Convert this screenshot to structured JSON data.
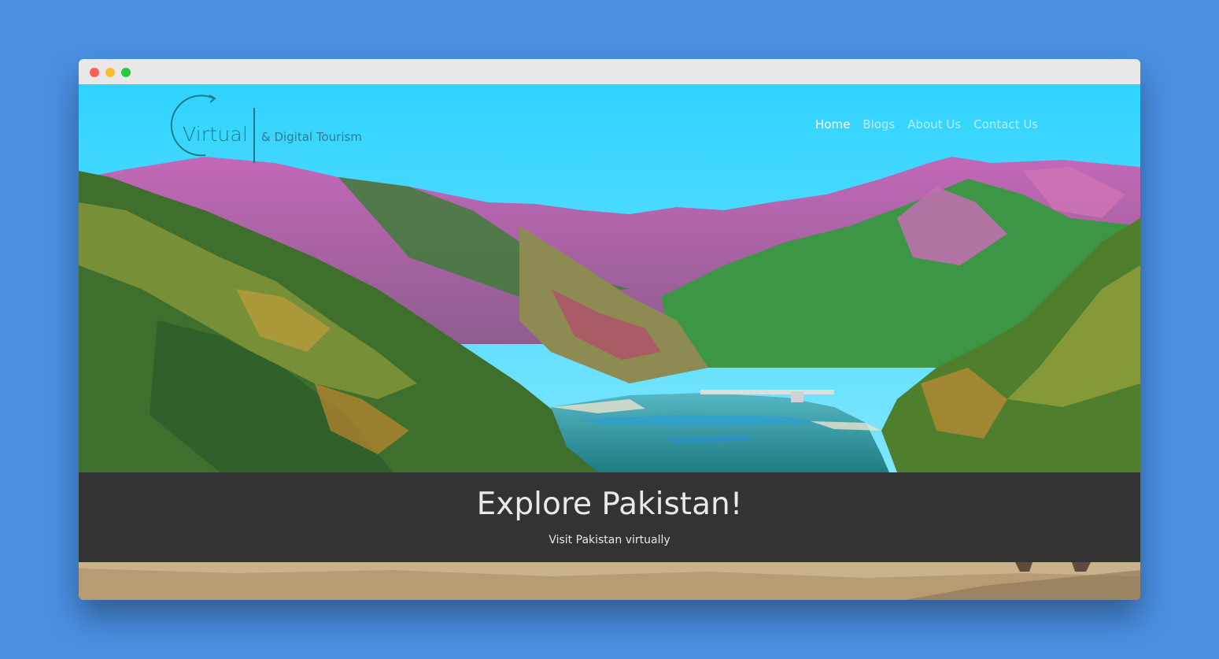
{
  "brand": {
    "logo_word": "Virtual",
    "tagline": "& Digital Tourism",
    "color": "#177c86"
  },
  "nav": {
    "items": [
      {
        "label": "Home",
        "active": true
      },
      {
        "label": "Blogs",
        "active": false
      },
      {
        "label": "About Us",
        "active": false
      },
      {
        "label": "Contact Us",
        "active": false
      }
    ]
  },
  "hero": {
    "title": "Explore Pakistan!",
    "subtitle": "Visit Pakistan virtually",
    "sky_color": "#38d6ff"
  },
  "window": {
    "controls": [
      "close-dot",
      "minimize-dot",
      "zoom-dot"
    ]
  }
}
